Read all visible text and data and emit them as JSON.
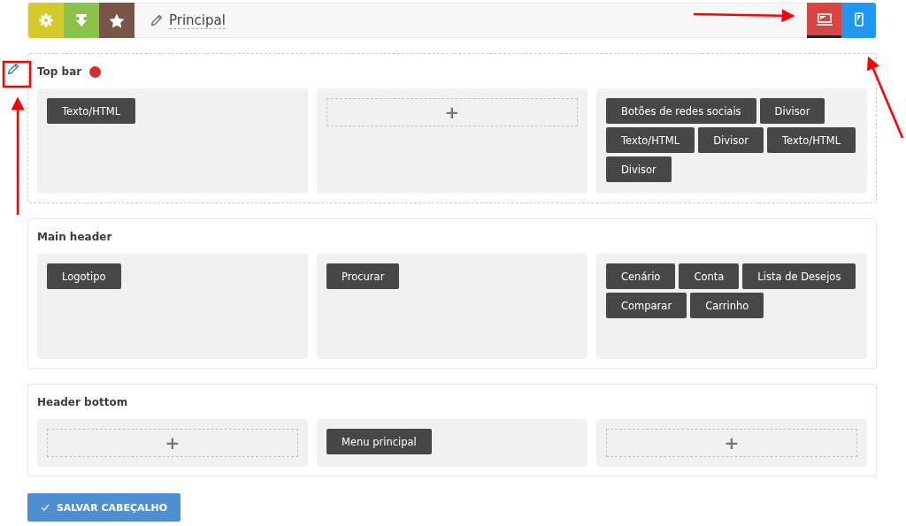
{
  "toolbar": {
    "tools": [
      {
        "kind": "gear",
        "color": "#d6c92c"
      },
      {
        "kind": "download",
        "color": "#8bc34a"
      },
      {
        "kind": "star",
        "color": "#795548"
      }
    ],
    "title": "Principal",
    "devices": [
      {
        "kind": "laptop",
        "color": "#d84545",
        "selected": true
      },
      {
        "kind": "phone",
        "color": "#2196f3",
        "selected": false
      }
    ]
  },
  "sections": [
    {
      "title": "Top bar",
      "active": true,
      "flagged": true,
      "columns": [
        {
          "kind": "items",
          "items": [
            "Texto/HTML"
          ]
        },
        {
          "kind": "add",
          "label": "+"
        },
        {
          "kind": "items",
          "items": [
            "Botões de redes sociais",
            "Divisor",
            "Texto/HTML",
            "Divisor",
            "Texto/HTML",
            "Divisor"
          ]
        }
      ]
    },
    {
      "title": "Main header",
      "active": false,
      "flagged": false,
      "columns": [
        {
          "kind": "items",
          "items": [
            "Logotipo"
          ]
        },
        {
          "kind": "items",
          "items": [
            "Procurar"
          ]
        },
        {
          "kind": "items",
          "items": [
            "Cenário",
            "Conta",
            "Lista de Desejos",
            "Comparar",
            "Carrinho"
          ]
        }
      ]
    },
    {
      "title": "Header bottom",
      "active": false,
      "flagged": false,
      "columns": [
        {
          "kind": "add",
          "label": "+"
        },
        {
          "kind": "items",
          "items": [
            "Menu principal"
          ]
        },
        {
          "kind": "add",
          "label": "+"
        }
      ]
    }
  ],
  "save_button": {
    "label": "SALVAR CABEÇALHO"
  }
}
